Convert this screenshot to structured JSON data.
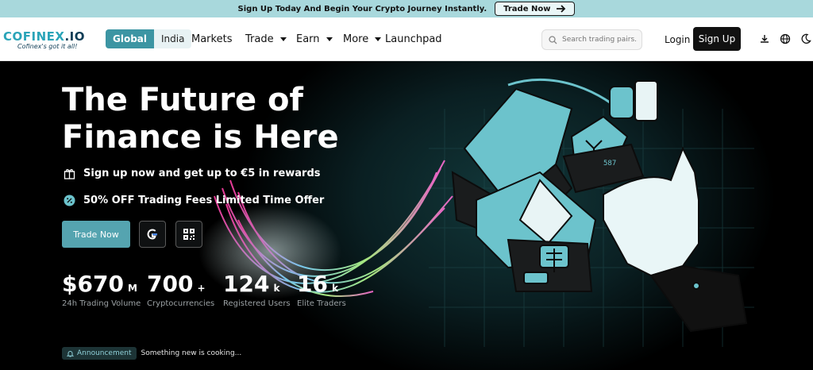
{
  "banner": {
    "text": "Sign Up Today And Begin Your Crypto Journey Instantly.",
    "button": "Trade Now"
  },
  "logo": {
    "main": "COFINEX",
    "suffix": ".IO",
    "tagline": "Cofinex's got it all!"
  },
  "region": {
    "active": "Global",
    "inactive": "India"
  },
  "nav": {
    "markets": "Markets",
    "trade": "Trade",
    "earn": "Earn",
    "more": "More",
    "launchpad": "Launchpad"
  },
  "search": {
    "placeholder": "Search trading pairs..."
  },
  "auth": {
    "login": "Login",
    "signup": "Sign Up"
  },
  "hero": {
    "title_line1": "The Future of",
    "title_line2": "Finance is Here",
    "feature1": "Sign up now and get up to €5 in rewards",
    "feature2": "50% OFF Trading Fees Limited Time Offer",
    "cta": "Trade Now"
  },
  "stats": [
    {
      "value": "$670",
      "unit": "M",
      "label": "24h Trading Volume"
    },
    {
      "value": "700",
      "unit": "+",
      "label": "Cryptocurrencies"
    },
    {
      "value": "124",
      "unit": "k",
      "label": "Registered Users"
    },
    {
      "value": "16",
      "unit": "k",
      "label": "Elite Traders"
    }
  ],
  "announcement": {
    "badge": "Announcement",
    "text": "Something new is cooking..."
  },
  "illustration": {
    "card_text": "587"
  },
  "colors": {
    "accent": "#55a4b0",
    "banner": "#a8d8dc",
    "illustration": "#6cc3cc"
  }
}
